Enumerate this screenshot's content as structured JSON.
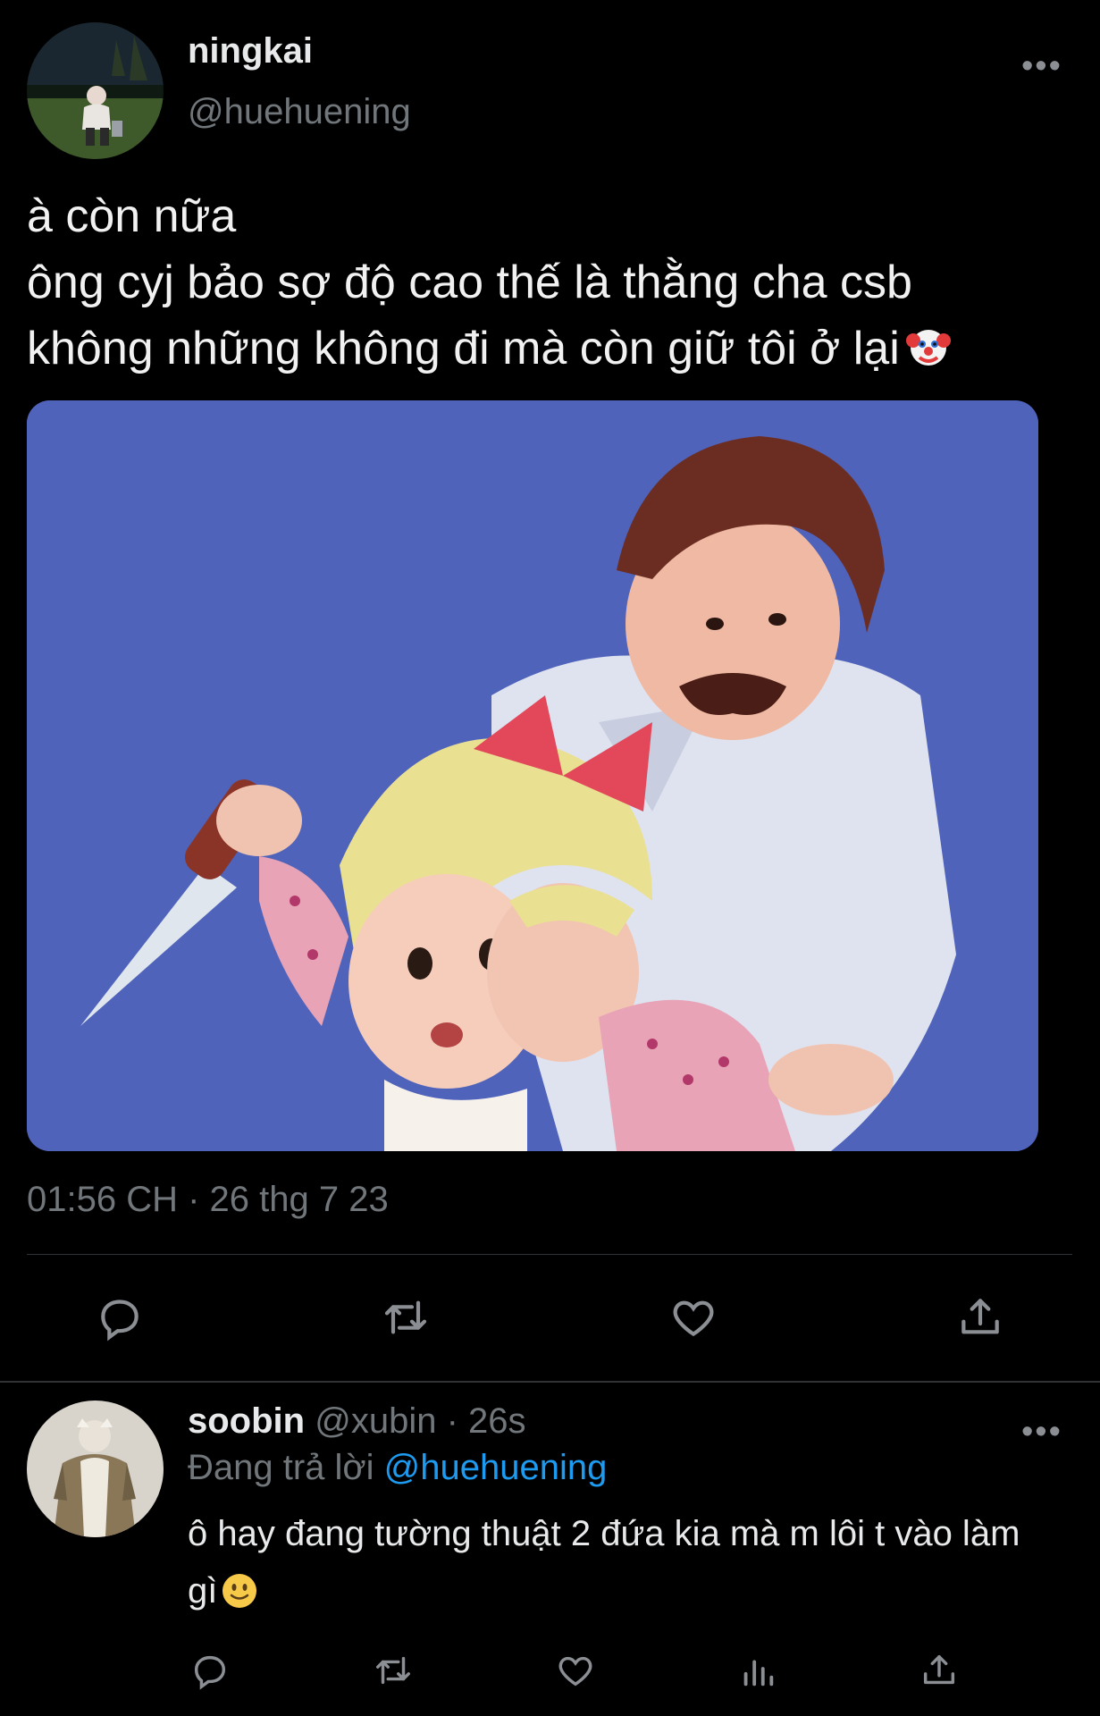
{
  "main_tweet": {
    "display_name": "ningkai",
    "handle": "@huehuening",
    "more_label": "•••",
    "text_lines": [
      "à còn nữa",
      "ông cyj bảo sợ độ cao thế là thằng cha csb",
      "không những không đi mà còn giữ tôi ở lại"
    ],
    "emoji": "clown-face-icon",
    "media": "cartoon image: man holding a knife and a blonde girl with a red bow",
    "timestamp": "01:56 CH · 26 thg 7 23",
    "actions": [
      "reply-icon",
      "retweet-icon",
      "like-icon",
      "share-icon"
    ]
  },
  "reply_tweet": {
    "display_name": "soobin",
    "handle": "@xubin",
    "separator": " · ",
    "time": "26s",
    "more_label": "•••",
    "replying_to_prefix": "Đang trả lời ",
    "replying_to_handle": "@huehuening",
    "text": "ô hay đang tường thuật 2 đứa kia mà m lôi t vào làm gì",
    "emoji": "slightly-smiling-face-icon",
    "actions": [
      "reply-icon",
      "retweet-icon",
      "like-icon",
      "views-icon",
      "share-icon"
    ]
  },
  "colors": {
    "background": "#000000",
    "text": "#e7e9ea",
    "secondary": "#71767b",
    "link": "#1d9bf0",
    "divider": "#2f3336"
  }
}
